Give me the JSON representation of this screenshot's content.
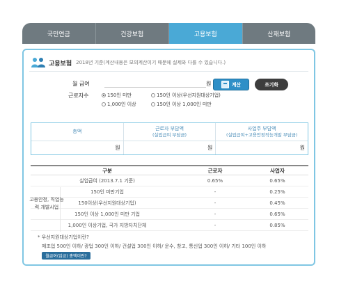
{
  "tabs": [
    {
      "label": "국민연금"
    },
    {
      "label": "건강보험"
    },
    {
      "label": "고용보험"
    },
    {
      "label": "산재보험"
    }
  ],
  "active_tab": 2,
  "header": {
    "icon": "people-icon",
    "title": "고용보험",
    "note": "2018년 기준(계산내용은 모의계산이기 때문에 실제와 다를 수 있습니다.)"
  },
  "form": {
    "salary_label": "월 급여",
    "salary_value": "",
    "salary_unit": "원",
    "calc_label": "계산",
    "reset_label": "초기화",
    "workers_label": "근로자수",
    "options": [
      {
        "label": "150인 미만",
        "checked": true
      },
      {
        "label": "150인 이상(우선지원대상기업)",
        "checked": false
      },
      {
        "label": "1,000인 이상",
        "checked": false
      },
      {
        "label": "150인 이상 1,000인 미만",
        "checked": false
      }
    ]
  },
  "result": {
    "headers": [
      {
        "title": "총액",
        "sub": ""
      },
      {
        "title": "근로자 부담액",
        "sub": "(실업급여 부담금)"
      },
      {
        "title": "사업주 부담액",
        "sub": "(실업급여+고용안정직능개발 부담금)"
      }
    ],
    "unit": "원"
  },
  "rates": {
    "headers": [
      "구분",
      "근로자",
      "사업자"
    ],
    "rows": [
      {
        "kind": "실업급여 (2013.7.1 기준)",
        "worker": "0.65%",
        "biz": "0.65%"
      },
      {
        "kind": "150인 미만기업",
        "worker": "-",
        "biz": "0.25%"
      },
      {
        "kind": "150이상(우선지원대상기업)",
        "worker": "-",
        "biz": "0.45%"
      },
      {
        "kind": "150인 이상 1,000인 미만 기업",
        "worker": "-",
        "biz": "0.65%"
      },
      {
        "kind": "1,000인 이상기업, 국가 지방자치단체",
        "worker": "-",
        "biz": "0.85%"
      }
    ],
    "group_label": "고용안정, 직업능력 개발사업"
  },
  "notes": {
    "line1": "* 우선지원대상기업이란?",
    "line2": "제조업 500인 이하/ 광업 300인 이하/ 건설업 300인 이하/ 운수, 창고, 통신업 300인 이하/ 기타 100인 이하",
    "button": "월급여(임금) 총액이란?"
  }
}
